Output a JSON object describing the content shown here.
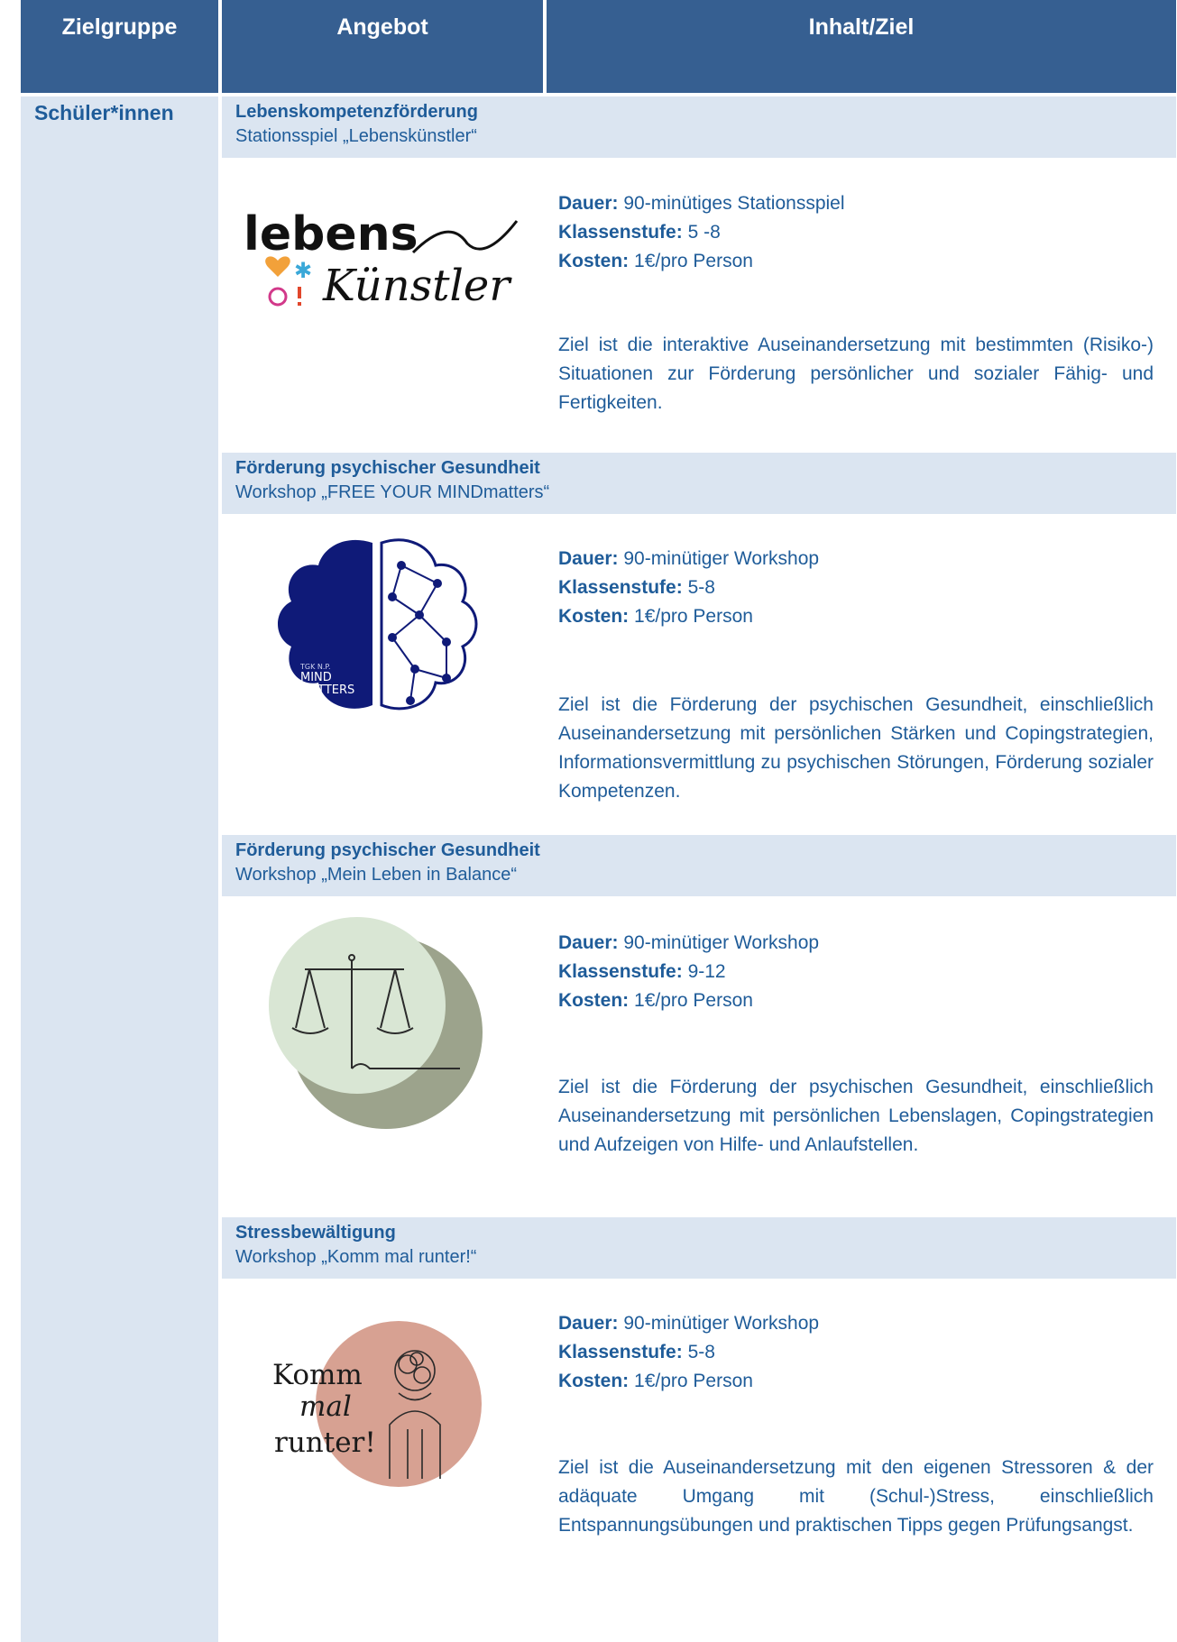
{
  "header": {
    "col1": "Zielgruppe",
    "col2": "Angebot",
    "col3": "Inhalt/Ziel"
  },
  "group_label": "Schüler*innen",
  "offers": [
    {
      "category": "Lebenskompetenzförderung",
      "title": "Stationsspiel „Lebenskünstler“",
      "dauer_label": "Dauer:",
      "dauer": "90-minütiges Stationsspiel",
      "stufe_label": "Klassenstufe:",
      "stufe": "5 -8",
      "kosten_label": "Kosten:",
      "kosten": "1€/pro Person",
      "ziel": "Ziel ist die interaktive Auseinandersetzung mit bestimmten (Risiko-) Situationen zur Förderung persönlicher und sozialer Fähig- und Fertigkeiten.",
      "logo_text_1": "lebens",
      "logo_text_2": "Künstler"
    },
    {
      "category": "Förderung psychischer Gesundheit",
      "title": "Workshop „FREE YOUR MINDmatters“",
      "dauer_label": "Dauer:",
      "dauer": "90-minütiger Workshop",
      "stufe_label": "Klassenstufe:",
      "stufe": "5-8",
      "kosten_label": "Kosten:",
      "kosten": "1€/pro Person",
      "ziel": "Ziel ist die Förderung der psychischen Gesundheit, einschließlich Auseinandersetzung mit persönlichen Stärken und Copingstrategien, Informationsvermittlung zu psychischen Störungen, Förderung sozialer Kompetenzen.",
      "logo_text_1": "MIND",
      "logo_text_2": "MATTERS"
    },
    {
      "category": "Förderung psychischer Gesundheit",
      "title": "Workshop „Mein Leben in Balance“",
      "dauer_label": "Dauer:",
      "dauer": "90-minütiger Workshop",
      "stufe_label": "Klassenstufe:",
      "stufe": "9-12",
      "kosten_label": "Kosten:",
      "kosten": "1€/pro Person",
      "ziel": "Ziel ist die Förderung der psychischen Gesundheit, einschließlich Auseinandersetzung mit persönlichen Lebenslagen, Copingstrategien und Aufzeigen von Hilfe- und Anlaufstellen."
    },
    {
      "category": "Stressbewältigung",
      "title": "Workshop „Komm mal runter!“",
      "dauer_label": "Dauer:",
      "dauer": "90-minütiger Workshop",
      "stufe_label": "Klassenstufe:",
      "stufe": "5-8",
      "kosten_label": "Kosten:",
      "kosten": "1€/pro Person",
      "ziel": "Ziel ist die Auseinandersetzung mit den eigenen Stressoren & der adäquate Umgang mit (Schul-)Stress, einschließlich Entspannungsübungen und praktischen Tipps gegen Prüfungsangst.",
      "logo_text_1": "Komm",
      "logo_text_2": "mal",
      "logo_text_3": "runter!"
    }
  ],
  "colors": {
    "header_bg": "#365f91",
    "light_bg": "#dbe5f1",
    "text_blue": "#1f5c99"
  }
}
